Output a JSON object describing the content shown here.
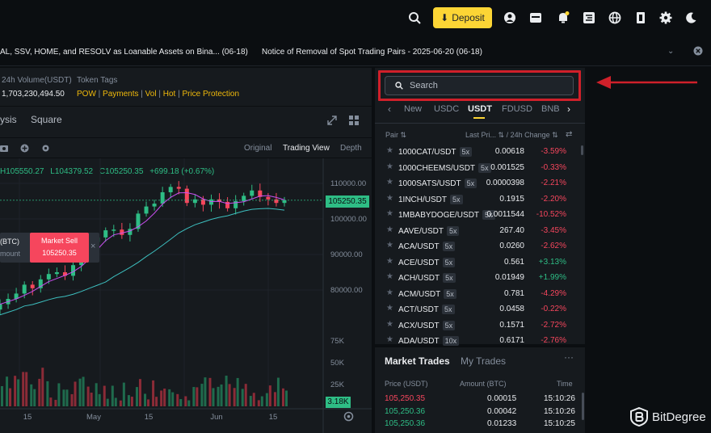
{
  "topnav": {
    "deposit_label": "Deposit",
    "icons": [
      "search-icon",
      "user-icon",
      "wallet-icon",
      "bell-icon",
      "download-icon",
      "globe-icon",
      "exit-icon",
      "gear-icon",
      "moon-icon"
    ]
  },
  "announcements": [
    "AL, SSV, HOME, and RESOLV as Loanable Assets on Bina...  (06-18)",
    "Notice of Removal of Spot Trading Pairs - 2025-06-20 (06-18)"
  ],
  "stats": {
    "volume_label": "24h Volume(USDT)",
    "volume_value": "1,703,230,494.50",
    "tags_label": "Token Tags",
    "tags": [
      "POW",
      "Payments",
      "Vol",
      "Hot",
      "Price Protection"
    ]
  },
  "chart_tabs": {
    "left": [
      "ysis",
      "Square"
    ],
    "views": [
      "Original",
      "Trading View",
      "Depth"
    ]
  },
  "ohlc": {
    "h": "H105550.27",
    "l": "L104379.52",
    "c": "C105250.35",
    "change": "+699.18 (+0.67%)"
  },
  "order_popup": {
    "left_label": "(BTC)",
    "left_sub": "mount",
    "sell_label": "Market Sell",
    "sell_price": "105250.35",
    "close": "×"
  },
  "chart_data": {
    "type": "line",
    "price_axis": [
      "110000.00",
      "100000.00",
      "90000.00",
      "80000.00"
    ],
    "current_price": "105250.35",
    "volume_axis": [
      "75K",
      "50K",
      "25K"
    ],
    "current_volume": "3.18K",
    "x_labels": [
      "15",
      "May",
      "15",
      "Jun",
      "15"
    ],
    "series": [
      {
        "values": [
          76000,
          77500,
          79000,
          81500,
          80500,
          83000,
          84500,
          85000,
          84000,
          87000,
          90500,
          93500,
          94800,
          96800,
          97000,
          95500,
          97200,
          101500,
          103500,
          104300,
          107500,
          109000,
          108500,
          104500,
          105500,
          104000,
          105500,
          104800,
          103000,
          105000,
          106500,
          108000,
          106200,
          105500,
          104500,
          105250
        ]
      }
    ]
  },
  "search": {
    "placeholder": "Search"
  },
  "market_tabs": [
    "New",
    "USDC",
    "USDT",
    "FDUSD",
    "BNB"
  ],
  "market_headers": {
    "pair": "Pair",
    "last_price": "Last Pri...",
    "change": "/ 24h Change"
  },
  "markets": [
    {
      "pair": "1000CAT/USDT",
      "lev": "5x",
      "price": "0.00618",
      "change": "-3.59%",
      "up": false
    },
    {
      "pair": "1000CHEEMS/USDT",
      "lev": "5x",
      "price": "0.001525",
      "change": "-0.33%",
      "up": false
    },
    {
      "pair": "1000SATS/USDT",
      "lev": "5x",
      "price": "0.0000398",
      "change": "-2.21%",
      "up": false
    },
    {
      "pair": "1INCH/USDT",
      "lev": "5x",
      "price": "0.1915",
      "change": "-2.20%",
      "up": false
    },
    {
      "pair": "1MBABYDOGE/USDT",
      "lev": "5x",
      "price": "0.0011544",
      "change": "-10.52%",
      "up": false
    },
    {
      "pair": "AAVE/USDT",
      "lev": "5x",
      "price": "267.40",
      "change": "-3.45%",
      "up": false
    },
    {
      "pair": "ACA/USDT",
      "lev": "5x",
      "price": "0.0260",
      "change": "-2.62%",
      "up": false
    },
    {
      "pair": "ACE/USDT",
      "lev": "5x",
      "price": "0.561",
      "change": "+3.13%",
      "up": true
    },
    {
      "pair": "ACH/USDT",
      "lev": "5x",
      "price": "0.01949",
      "change": "+1.99%",
      "up": true
    },
    {
      "pair": "ACM/USDT",
      "lev": "5x",
      "price": "0.781",
      "change": "-4.29%",
      "up": false
    },
    {
      "pair": "ACT/USDT",
      "lev": "5x",
      "price": "0.0458",
      "change": "-0.22%",
      "up": false
    },
    {
      "pair": "ACX/USDT",
      "lev": "5x",
      "price": "0.1571",
      "change": "-2.72%",
      "up": false
    },
    {
      "pair": "ADA/USDT",
      "lev": "10x",
      "price": "0.6171",
      "change": "-2.76%",
      "up": false
    }
  ],
  "trades": {
    "tabs": [
      "Market Trades",
      "My Trades"
    ],
    "more": "···",
    "headers": [
      "Price (USDT)",
      "Amount (BTC)",
      "Time"
    ],
    "rows": [
      {
        "price": "105,250.35",
        "amount": "0.00015",
        "time": "15:10:26",
        "up": false
      },
      {
        "price": "105,250.36",
        "amount": "0.00042",
        "time": "15:10:26",
        "up": true
      },
      {
        "price": "105,250.36",
        "amount": "0.01233",
        "time": "15:10:25",
        "up": true
      }
    ]
  },
  "brand": {
    "name": "BitDegree"
  },
  "colors": {
    "accent": "#fcd535",
    "up": "#2ebd85",
    "down": "#f6465d",
    "highlight": "#d0202a"
  }
}
